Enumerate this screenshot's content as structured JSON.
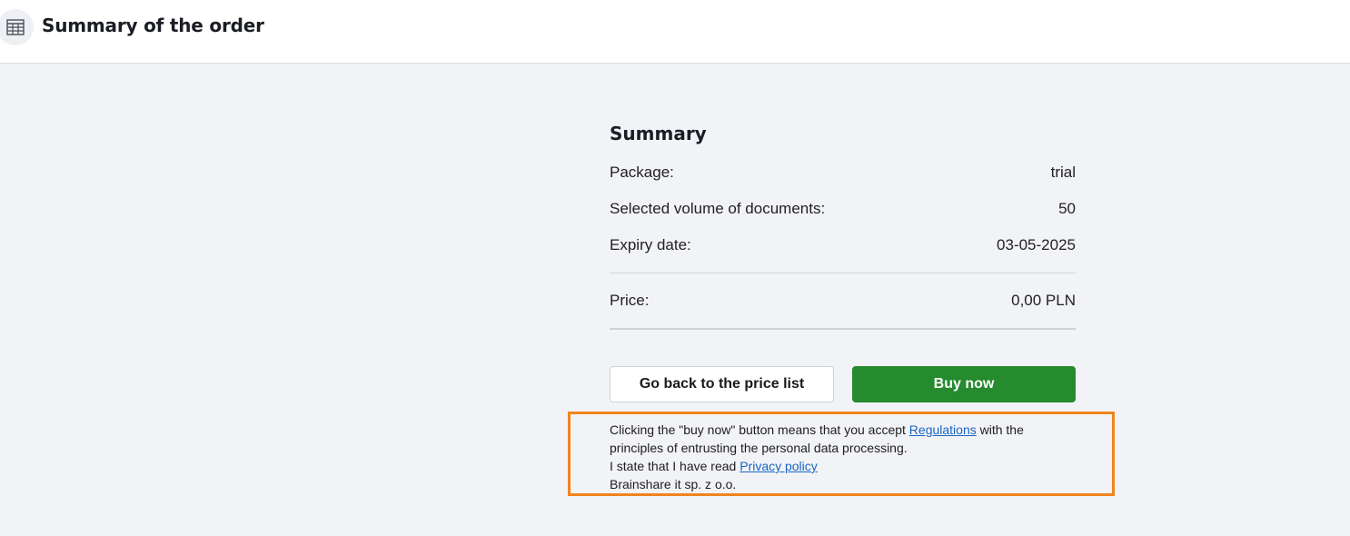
{
  "header": {
    "title": "Summary of the order",
    "icon": "table-building-icon"
  },
  "summary": {
    "heading": "Summary",
    "package_label": "Package:",
    "package_value": "trial",
    "volume_label": "Selected volume of documents:",
    "volume_value": "50",
    "expiry_label": "Expiry date:",
    "expiry_value": "03-05-2025",
    "price_label": "Price:",
    "price_value": "0,00 PLN"
  },
  "buttons": {
    "back_label": "Go back to the price list",
    "buy_label": "Buy now"
  },
  "legal": {
    "line1_before": "Clicking the \"buy now\" button means that you accept ",
    "regulations_link": "Regulations",
    "line1_after": " with the",
    "line2": "principles of entrusting the personal data processing.",
    "line3_before": "I state that I have read ",
    "privacy_link": "Privacy policy",
    "line4": "Brainshare it sp. z o.o."
  },
  "colors": {
    "buy_button": "#268a2e",
    "highlight_border": "#f0841c",
    "link": "#1a66c2",
    "page_background": "#f2f3f7"
  }
}
